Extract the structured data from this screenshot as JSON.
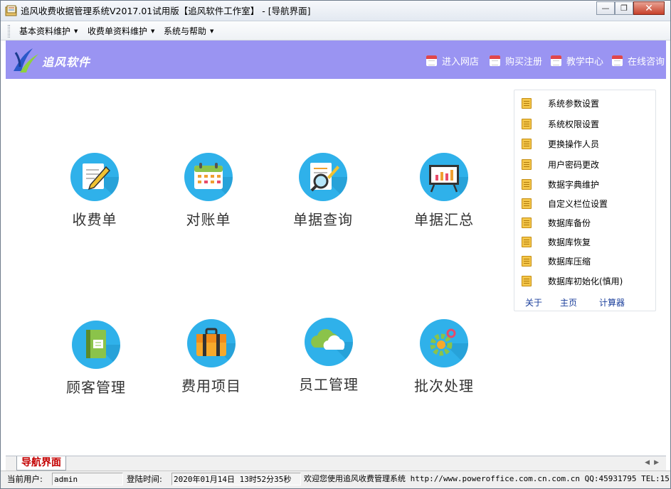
{
  "window": {
    "title": "追风收费收据管理系统V2017.01试用版【追风软件工作室】 - [导航界面]"
  },
  "menu": [
    {
      "label": "基本资料维护"
    },
    {
      "label": "收费单资料维护"
    },
    {
      "label": "系统与帮助"
    }
  ],
  "banner": {
    "brand": "追风软件",
    "bg_color": "#9a94f2",
    "links": [
      {
        "label": "进入网店",
        "icon": "calendar-icon"
      },
      {
        "label": "购买注册",
        "icon": "calendar-icon"
      },
      {
        "label": "教学中心",
        "icon": "calendar-icon"
      },
      {
        "label": "在线咨询",
        "icon": "calendar-icon"
      }
    ]
  },
  "tiles": [
    {
      "label": "收费单",
      "icon": "note-pencil-icon"
    },
    {
      "label": "对账单",
      "icon": "calendar-icon"
    },
    {
      "label": "单据查询",
      "icon": "magnifier-icon"
    },
    {
      "label": "单据汇总",
      "icon": "board-chart-icon"
    },
    {
      "label": "顾客管理",
      "icon": "book-icon"
    },
    {
      "label": "费用项目",
      "icon": "briefcase-icon"
    },
    {
      "label": "员工管理",
      "icon": "cloud-icon"
    },
    {
      "label": "批次处理",
      "icon": "gear-icon"
    }
  ],
  "tile_color": "#2fb1ea",
  "panel": {
    "items": [
      {
        "label": "系统参数设置"
      },
      {
        "label": "系统权限设置"
      },
      {
        "label": "更换操作人员"
      },
      {
        "label": "用户密码更改"
      },
      {
        "label": "数据字典维护"
      },
      {
        "label": "自定义栏位设置"
      },
      {
        "label": "数据库备份"
      },
      {
        "label": "数据库恢复"
      },
      {
        "label": "数据库压缩"
      },
      {
        "label": "数据库初始化(慎用)"
      }
    ],
    "links": [
      {
        "label": "关于"
      },
      {
        "label": "主页"
      },
      {
        "label": "计算器"
      }
    ]
  },
  "bottom_tab": "导航界面",
  "status": {
    "user_label": "当前用户:",
    "user_value": "admin",
    "login_label": "登陆时间:",
    "login_value": "2020年01月14日 13时52分35秒",
    "welcome": "欢迎您使用追风收费管理系统 http://www.poweroffice.com.cn.com.cn QQ:45931795 TEL:15"
  }
}
